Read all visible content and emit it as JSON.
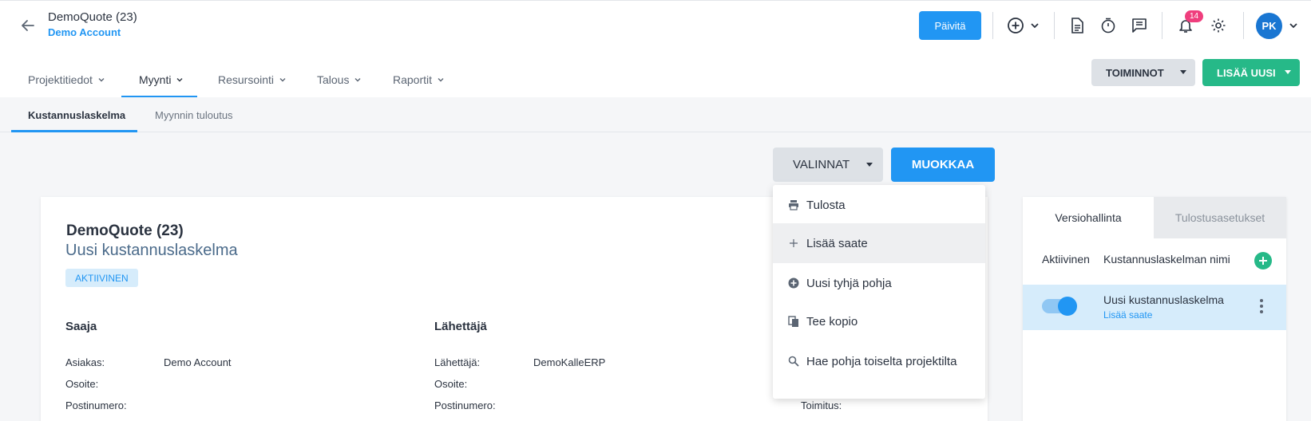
{
  "header": {
    "title": "DemoQuote (23)",
    "subtitle": "Demo Account",
    "update_label": "Päivitä",
    "notification_count": "14",
    "avatar_initials": "PK"
  },
  "main_nav": {
    "tabs": [
      {
        "label": "Projektitiedot"
      },
      {
        "label": "Myynti"
      },
      {
        "label": "Resursointi"
      },
      {
        "label": "Talous"
      },
      {
        "label": "Raportit"
      }
    ],
    "active_tab": "Myynti",
    "actions_label": "TOIMINNOT",
    "add_new_label": "LISÄÄ UUSI"
  },
  "sub_nav": {
    "tabs": [
      {
        "label": "Kustannuslaskelma"
      },
      {
        "label": "Myynnin tuloutus"
      }
    ],
    "active_tab": "Kustannuslaskelma"
  },
  "toolbar": {
    "options_label": "VALINNAT",
    "edit_label": "MUOKKAA"
  },
  "options_menu": {
    "items": [
      {
        "label": "Tulosta",
        "icon": "print-icon"
      },
      {
        "label": "Lisää saate",
        "icon": "plus-icon"
      },
      {
        "label": "Uusi tyhjä pohja",
        "icon": "add-circle-icon"
      },
      {
        "label": "Tee kopio",
        "icon": "copy-icon"
      },
      {
        "label": "Hae pohja toiselta projektilta",
        "icon": "search-icon"
      }
    ],
    "hovered_item": "Lisää saate"
  },
  "document": {
    "title": "DemoQuote (23)",
    "subtitle": "Uusi kustannuslaskelma",
    "status": "AKTIIVINEN",
    "recipient": {
      "heading": "Saaja",
      "fields": [
        {
          "label": "Asiakas:",
          "value": "Demo Account"
        },
        {
          "label": "Osoite:",
          "value": ""
        },
        {
          "label": "Postinumero:",
          "value": ""
        }
      ]
    },
    "sender": {
      "heading": "Lähettäjä",
      "fields": [
        {
          "label": "Lähettäjä:",
          "value": "DemoKalleERP"
        },
        {
          "label": "Osoite:",
          "value": ""
        },
        {
          "label": "Postinumero:",
          "value": ""
        }
      ]
    },
    "extra_field_label": "Toimitus:"
  },
  "version_panel": {
    "tabs": [
      {
        "label": "Versiohallinta"
      },
      {
        "label": "Tulostusasetukset"
      }
    ],
    "active_tab": "Versiohallinta",
    "col_active": "Aktiivinen",
    "col_name": "Kustannuslaskelman nimi",
    "rows": [
      {
        "name": "Uusi kustannuslaskelma",
        "link": "Lisää saate",
        "active": true
      }
    ]
  },
  "colors": {
    "primary": "#2196f3",
    "success": "#26b988",
    "badge": "#ef3e7d",
    "avatar": "#1976d2"
  }
}
